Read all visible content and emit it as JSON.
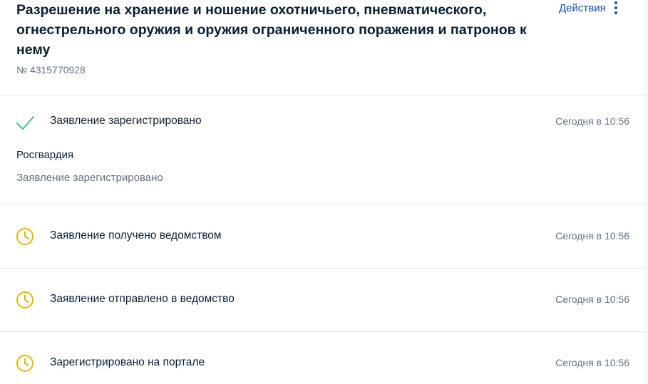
{
  "header": {
    "title": "Разрешение на хранение и ношение охотничьего, пневматического, огнестрельного оружия и оружия ограниченного поражения и патронов к нему",
    "number": "№ 4315770928",
    "actions_label": "Действия"
  },
  "events": [
    {
      "icon": "check-icon",
      "title": "Заявление зарегистрировано",
      "time": "Сегодня в 10:56",
      "organization": "Росгвардия",
      "status_text": "Заявление зарегистрировано"
    },
    {
      "icon": "clock-icon",
      "title": "Заявление получено ведомством",
      "time": "Сегодня в 10:56"
    },
    {
      "icon": "clock-icon",
      "title": "Заявление отправлено в ведомство",
      "time": "Сегодня в 10:56"
    },
    {
      "icon": "clock-icon",
      "title": "Зарегистрировано на портале",
      "time": "Сегодня в 10:56"
    }
  ],
  "colors": {
    "accent": "#0d4cd3",
    "success": "#2ec36c",
    "pending": "#e9b600",
    "muted_text": "#66727f",
    "divider": "#e3e8ee"
  }
}
